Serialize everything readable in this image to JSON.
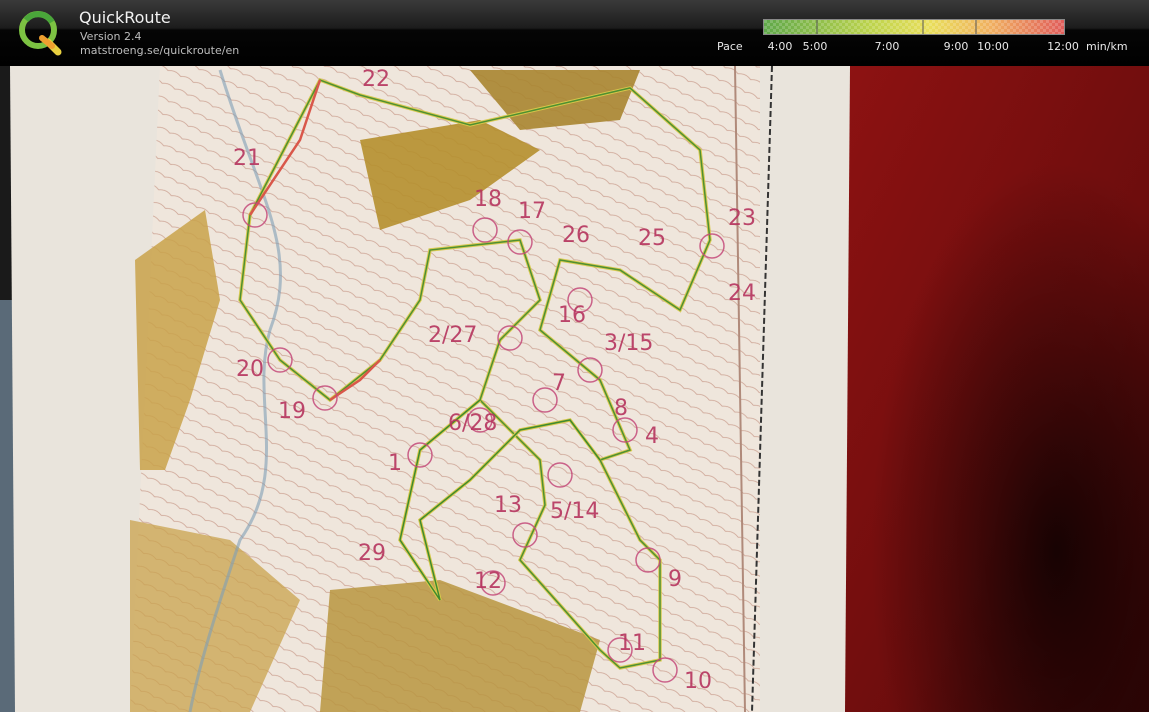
{
  "header": {
    "app_title": "QuickRoute",
    "app_version": "Version 2.4",
    "app_url": "matstroeng.se/quickroute/en",
    "logo_icon": "quickroute-logo-icon"
  },
  "pace_legend": {
    "label": "Pace",
    "unit": "min/km",
    "ticks": [
      "4:00",
      "5:00",
      "7:00",
      "9:00",
      "10:00",
      "12:00"
    ],
    "colors": [
      "#5fa84a",
      "#cfd94a",
      "#e8b43c",
      "#d9574a"
    ]
  },
  "map": {
    "control_labels": [
      "21",
      "22",
      "23",
      "24",
      "25",
      "26",
      "17",
      "18",
      "16",
      "3/15",
      "2/27",
      "20",
      "19",
      "7",
      "8",
      "4",
      "6/28",
      "1",
      "13",
      "5/14",
      "12",
      "9",
      "11",
      "10",
      "29"
    ]
  }
}
